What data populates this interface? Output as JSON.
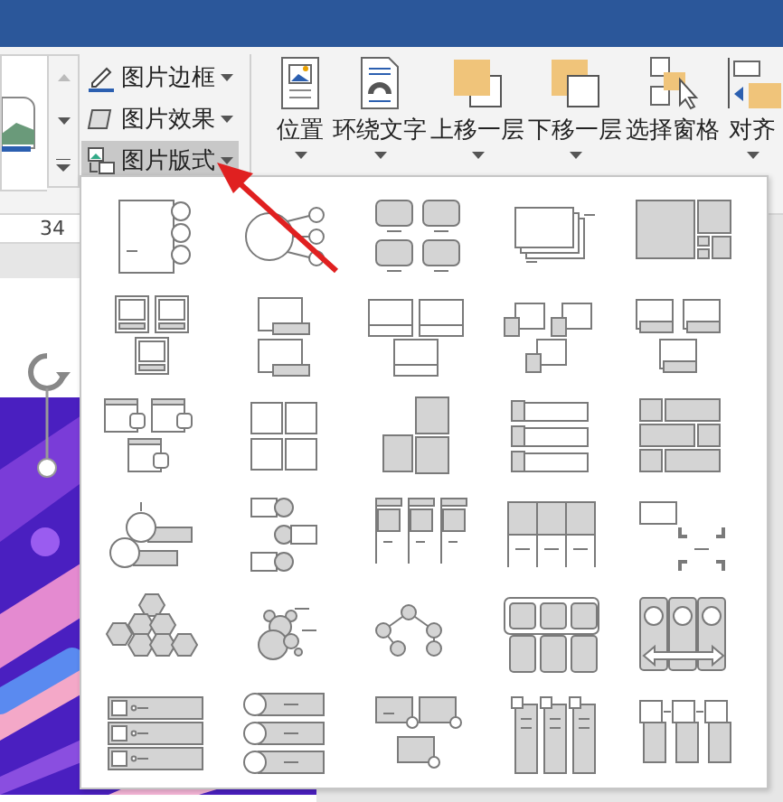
{
  "ribbon": {
    "small_buttons": [
      {
        "label": "图片边框",
        "kind": "border",
        "selected": false
      },
      {
        "label": "图片效果",
        "kind": "effects",
        "selected": false
      },
      {
        "label": "图片版式",
        "kind": "layout",
        "selected": true
      }
    ],
    "large_buttons": [
      {
        "label": "位置",
        "kind": "position",
        "has_menu": true
      },
      {
        "label": "环绕文字",
        "kind": "wrap",
        "has_menu": true
      },
      {
        "label": "上移一层",
        "kind": "forward",
        "has_menu": true
      },
      {
        "label": "下移一层",
        "kind": "backward",
        "has_menu": true
      },
      {
        "label": "选择窗格",
        "kind": "pane",
        "has_menu": false
      },
      {
        "label": "对齐",
        "kind": "align",
        "has_menu": true
      }
    ]
  },
  "ruler": {
    "number": "34"
  },
  "layout_gallery": {
    "open": true
  }
}
